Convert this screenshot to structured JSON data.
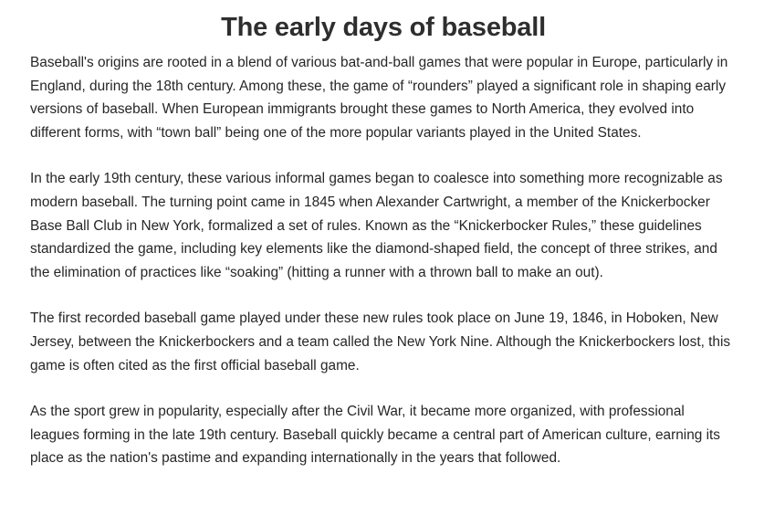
{
  "document": {
    "title": "The early days of baseball",
    "paragraphs": [
      "Baseball's origins are rooted in a blend of various bat-and-ball games that were popular in Europe, particularly in England, during the 18th century. Among these, the game of “rounders” played a significant role in shaping early versions of baseball. When European immigrants brought these games to North America, they evolved into different forms, with “town ball” being one of the more popular variants played in the United States.",
      "In the early 19th century, these various informal games began to coalesce into something more recognizable as modern baseball. The turning point came in 1845 when Alexander Cartwright, a member of the Knickerbocker Base Ball Club in New York, formalized a set of rules. Known as the “Knickerbocker Rules,” these guidelines standardized the game, including key elements like the diamond-shaped field, the concept of three strikes, and the elimination of practices like “soaking” (hitting a runner with a thrown ball to make an out).",
      "The first recorded baseball game played under these new rules took place on June 19, 1846, in Hoboken, New Jersey, between the Knickerbockers and a team called the New York Nine. Although the Knickerbockers lost, this game is often cited as the first official baseball game.",
      "As the sport grew in popularity, especially after the Civil War, it became more organized, with professional leagues forming in the late 19th century. Baseball quickly became a central part of American culture, earning its place as the nation's pastime and expanding internationally in the years that followed."
    ]
  }
}
